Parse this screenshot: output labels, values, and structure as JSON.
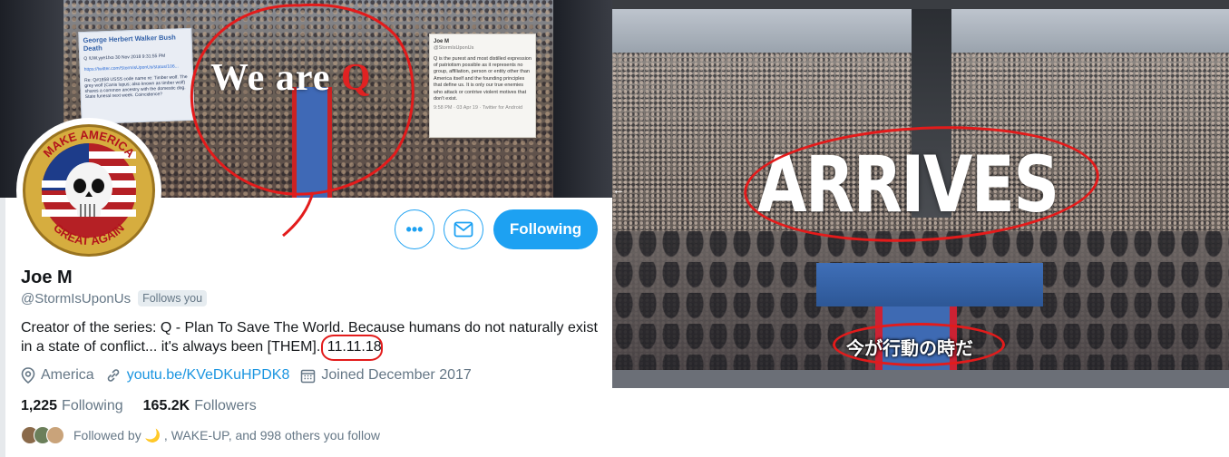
{
  "banner": {
    "overlay_text_main": "We are ",
    "overlay_text_q": "Q",
    "card_left": {
      "title": "George Herbert Walker Bush Death",
      "meta": "Q  !UW.yye1fxo  30 Nov 2018  9:31:55 PM",
      "link": "https://twitter.com/StormIsUponUs/status/106...",
      "body": "Re: Q#1858 USSS code name re: Timber wolf. The grey wolf (Canis lupus; also known as timber wolf) shares a common ancestry with the domestic dog. State funeral next week. Coincidence?"
    },
    "card_right": {
      "author": "Joe M",
      "handle": "@StormIsUponUs",
      "body": "Q is the purest and most distilled expression of patriotism possible as it represents no group, affiliation, person or entity other than America itself and the founding principles that define us. It is only our true enemies who attack or contrive violent motives that don't exist.",
      "footer": "9:58 PM · 03 Apr 19 · Twitter for Android"
    }
  },
  "avatar": {
    "top_text": "MAKE AMERICA",
    "bottom_text": "GREAT AGAIN",
    "icon": "skull-flag-emblem"
  },
  "actions": {
    "more_label": "•••",
    "message_icon": "mail-icon",
    "follow_label": "Following"
  },
  "profile": {
    "name": "Joe M",
    "handle": "@StormIsUponUs",
    "follows_you": "Follows you",
    "bio_text": "Creator of the series: Q - Plan To Save The World. Because humans do not naturally exist in a state of conflict... it's always been [THEM]. ",
    "bio_date": "11.11.18",
    "location": "America",
    "link": "youtu.be/KVeDKuHPDK8",
    "joined": "Joined December 2017",
    "following_count": "1,225",
    "following_label": "Following",
    "followers_count": "165.2K",
    "followers_label": "Followers",
    "followed_by": "Followed by 🌙 , WAKE-UP, and 998 others you follow"
  },
  "video": {
    "headline": "ARRIVES",
    "subtitle": "今が行動の時だ"
  },
  "colors": {
    "twitter_blue": "#1da1f2",
    "link_blue": "#1b95e0",
    "annotation_red": "#e31b1b"
  }
}
